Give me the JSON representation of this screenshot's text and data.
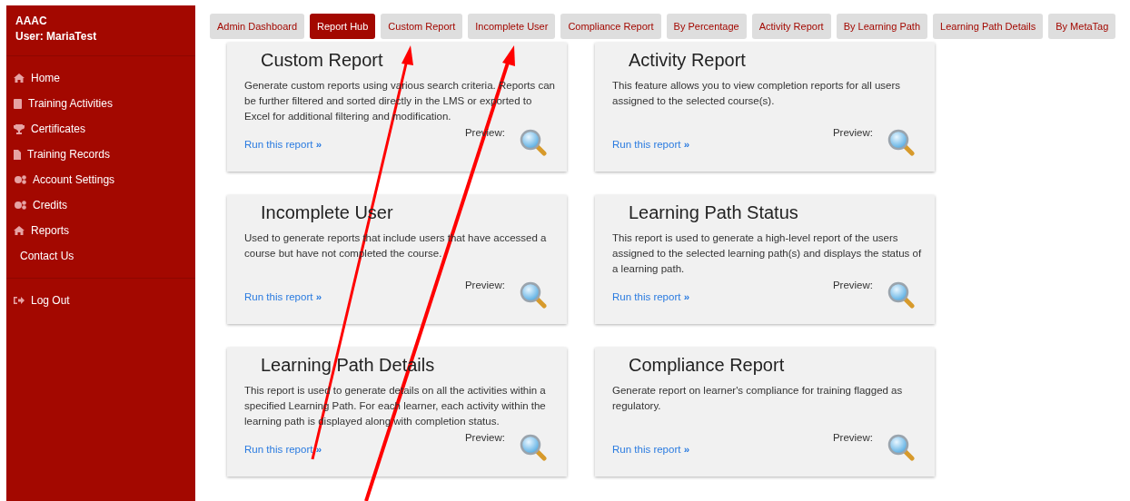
{
  "sidebar": {
    "org": "AAAC",
    "user": "User: MariaTest",
    "items": [
      {
        "label": "Home"
      },
      {
        "label": "Training Activities"
      },
      {
        "label": "Certificates"
      },
      {
        "label": "Training Records"
      },
      {
        "label": "Account Settings"
      },
      {
        "label": "Credits"
      },
      {
        "label": "Reports"
      },
      {
        "label": "Contact Us"
      }
    ],
    "logout": "Log Out"
  },
  "tabs": [
    {
      "label": "Admin Dashboard",
      "selected": false
    },
    {
      "label": "Report Hub",
      "selected": true
    },
    {
      "label": "Custom Report",
      "selected": false
    },
    {
      "label": "Incomplete User",
      "selected": false
    },
    {
      "label": "Compliance Report",
      "selected": false
    },
    {
      "label": "By Percentage",
      "selected": false
    },
    {
      "label": "Activity Report",
      "selected": false
    },
    {
      "label": "By Learning Path",
      "selected": false
    },
    {
      "label": "Learning Path Details",
      "selected": false
    },
    {
      "label": "By MetaTag",
      "selected": false
    }
  ],
  "cards": [
    {
      "title": "Custom Report",
      "description": "Generate custom reports using various search criteria. Reports can be further filtered and sorted directly in the LMS or exported to Excel for additional filtering and modification.",
      "link": "Run this report",
      "link_icon": "»",
      "preview": "Preview:"
    },
    {
      "title": "Activity Report",
      "description": "This feature allows you to view completion reports for all users assigned to the selected course(s).",
      "link": "Run this report",
      "link_icon": "»",
      "preview": "Preview:"
    },
    {
      "title": "Incomplete User",
      "description": "Used to generate reports that include users that have accessed a course but have not completed the course.",
      "link": "Run this report",
      "link_icon": "»",
      "preview": "Preview:"
    },
    {
      "title": "Learning Path Status",
      "description": "This report is used to generate a high-level report of the users assigned to the selected learning path(s) and displays the status of a learning path.",
      "link": "Run this report",
      "link_icon": "»",
      "preview": "Preview:"
    },
    {
      "title": "Learning Path Details",
      "description": "This report is used to generate details on all the activities within a specified Learning Path. For each learner, each activity within the learning path is displayed along with completion status.",
      "link": "Run this report",
      "link_icon": "»",
      "preview": "Preview:"
    },
    {
      "title": "Compliance Report",
      "description": "Generate report on learner's compliance for training flagged as regulatory.",
      "link": "Run this report",
      "link_icon": "»",
      "preview": "Preview:"
    }
  ]
}
